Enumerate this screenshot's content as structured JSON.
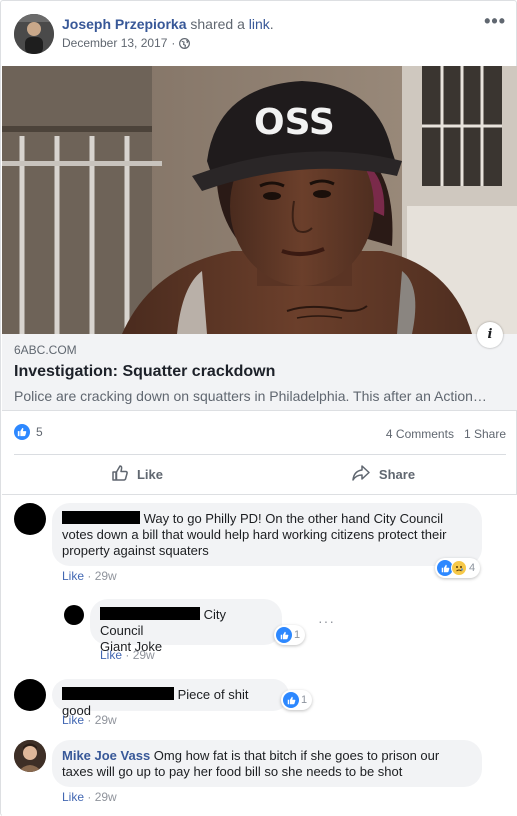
{
  "post": {
    "author": "Joseph Przepiorka",
    "shared_text": "shared a",
    "link_word": "link",
    "period": ".",
    "date": "December 13, 2017",
    "date_sep": "·",
    "privacy_icon": "globe-icon",
    "menu_icon": "more-dots-icon"
  },
  "link_preview": {
    "domain": "6ABC.COM",
    "title": "Investigation: Squatter crackdown",
    "description": "Police are cracking down on squatters in Philadelphia. This after an Action…",
    "cap_text": "OSS",
    "info_icon": "i"
  },
  "stats": {
    "like_count": "5",
    "comments": "4 Comments",
    "shares": "1 Share"
  },
  "actions": {
    "like_label": "Like",
    "share_label": "Share"
  },
  "comments": [
    {
      "text": "Way to go Philly PD! On the other hand City Council votes down a bill that would help hard working citizens protect their property against squaters",
      "like_label": "Like",
      "sep": "·",
      "time": "29w",
      "reaction_count": "4"
    },
    {
      "text": "City Council Giant Joke",
      "text_a": "City Council",
      "text_b": "Giant Joke",
      "like_label": "Like",
      "sep": "·",
      "time": "29w",
      "reaction_count": "1",
      "menu": "···"
    },
    {
      "text": "Piece of shit good",
      "like_label": "Like",
      "sep": "·",
      "time": "29w",
      "reaction_count": "1"
    },
    {
      "author": "Mike Joe Vass",
      "text": "Omg how fat is that bitch if she goes to prison our taxes will go up to pay her food bill so she needs to be shot",
      "like_label": "Like",
      "sep": "·",
      "time": "29w"
    }
  ],
  "colors": {
    "link_blue": "#385898",
    "like_blue": "#2d88ff",
    "bubble_bg": "#f2f3f5",
    "meta_gray": "#606770"
  }
}
